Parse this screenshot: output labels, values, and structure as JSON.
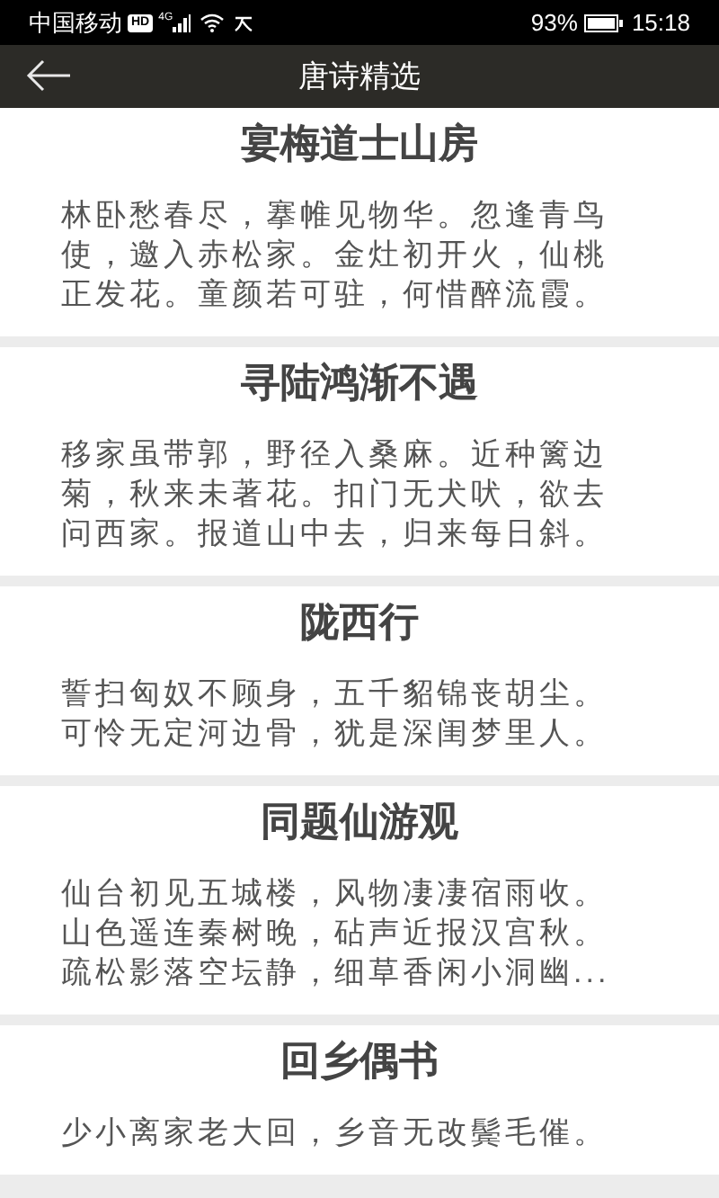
{
  "status_bar": {
    "carrier": "中国移动",
    "hd_badge": "HD",
    "network": "4G",
    "battery_percent": "93%",
    "time": "15:18"
  },
  "nav_bar": {
    "title": "唐诗精选"
  },
  "poems": [
    {
      "title": "宴梅道士山房",
      "lines": [
        "林卧愁春尽，搴帷见物华。忽逢青鸟",
        "使，邀入赤松家。金灶初开火，仙桃",
        "正发花。童颜若可驻，何惜醉流霞。"
      ]
    },
    {
      "title": "寻陆鸿渐不遇",
      "lines": [
        "移家虽带郭，野径入桑麻。近种篱边",
        "菊，秋来未著花。扣门无犬吠，欲去",
        "问西家。报道山中去，归来每日斜。"
      ]
    },
    {
      "title": "陇西行",
      "lines": [
        "誓扫匈奴不顾身，五千貂锦丧胡尘。",
        "可怜无定河边骨，犹是深闺梦里人。"
      ]
    },
    {
      "title": "同题仙游观",
      "lines": [
        "仙台初见五城楼，风物凄凄宿雨收。",
        "山色遥连秦树晚，砧声近报汉宫秋。",
        "疏松影落空坛静，细草香闲小洞幽..."
      ]
    },
    {
      "title": "回乡偶书",
      "lines": [
        "少小离家老大回，乡音无改鬓毛催。"
      ]
    }
  ]
}
